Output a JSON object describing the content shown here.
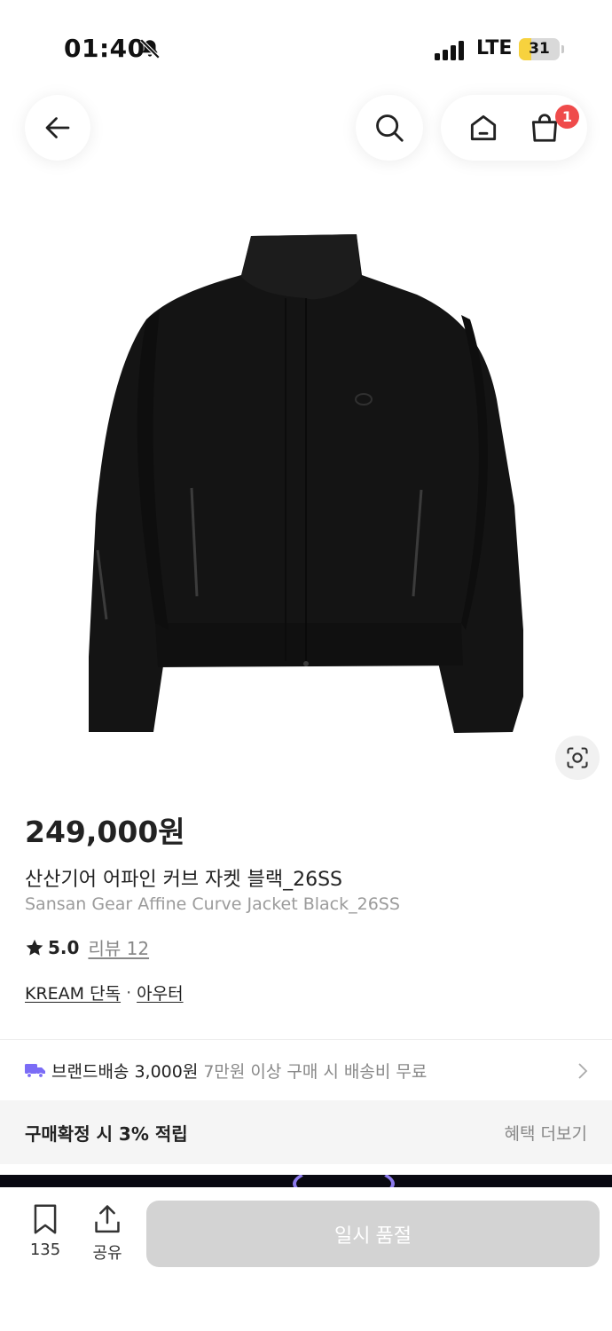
{
  "status_bar": {
    "time": "01:40",
    "network": "LTE",
    "battery": "31",
    "battery_level": 0.31,
    "bell_icon": "bell-slash-icon"
  },
  "nav": {
    "back_icon": "arrow-left-icon",
    "search_icon": "search-icon",
    "home_icon": "home-icon",
    "cart_icon": "shopping-bag-icon",
    "cart_badge": "1"
  },
  "product": {
    "image_alt_icon": "jacket-image",
    "price": "249,000원",
    "name_ko": "산산기어 어파인 커브 자켓 블랙_26SS",
    "name_en": "Sansan Gear Affine Curve Jacket Black_26SS",
    "rating": "5.0",
    "review_label": "리뷰 12",
    "tags": [
      "KREAM 단독",
      "아우터"
    ],
    "tag_separator": "·"
  },
  "delivery": {
    "label": "브랜드배송 3,000원",
    "note": "7만원 이상 구매 시 배송비 무료",
    "icon": "truck-icon"
  },
  "benefit": {
    "text": "구매확정 시 3% 적립",
    "more": "혜택 더보기"
  },
  "bottom_bar": {
    "bookmark_count": "135",
    "share_label": "공유",
    "soldout_label": "일시 품절"
  },
  "colors": {
    "badge": "#ef4b4b",
    "truck": "#7b6cf6",
    "soldout_button": "#d3d3d3",
    "battery_fill": "#f7d23e"
  }
}
